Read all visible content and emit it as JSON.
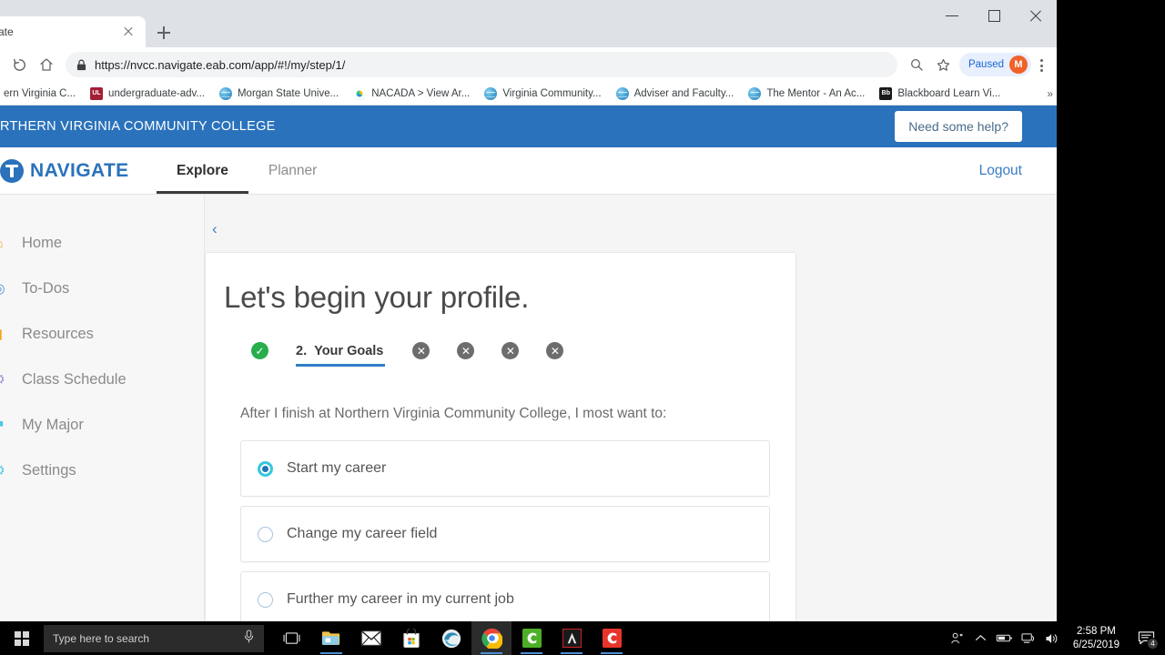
{
  "browser": {
    "tab": {
      "title": "ate",
      "close_icon": "close-icon"
    },
    "new_tab_icon": "plus-icon",
    "window_controls": {
      "minimize": "minimize-icon",
      "maximize": "maximize-icon",
      "close": "close-icon"
    },
    "toolbar": {
      "reload_icon": "reload-icon",
      "home_icon": "home-icon",
      "lock_icon": "lock-icon",
      "url_secure": "https://",
      "url_host": "nvcc.navigate.eab.com",
      "url_path": "/app/#!/my/step/1/",
      "url_full": "https://nvcc.navigate.eab.com/app/#!/my/step/1/",
      "zoom_icon": "zoom-search-icon",
      "bookmark_icon": "star-icon",
      "paused_label": "Paused",
      "avatar_initial": "M",
      "menu_icon": "kebab-menu-icon"
    },
    "bookmarks": [
      {
        "label": "ern Virginia C...",
        "icon": "globe-icon",
        "icon_kind": "globe"
      },
      {
        "label": "undergraduate-adv...",
        "icon": "ul-icon",
        "icon_kind": "ul",
        "icon_text": "UL",
        "icon_color": "#a31f34"
      },
      {
        "label": "Morgan State Unive...",
        "icon": "globe-icon",
        "icon_kind": "globe"
      },
      {
        "label": "NACADA > View Ar...",
        "icon": "nacada-icon",
        "icon_kind": "ring"
      },
      {
        "label": "Virginia Community...",
        "icon": "globe-icon",
        "icon_kind": "globe"
      },
      {
        "label": "Adviser and Faculty...",
        "icon": "globe-icon",
        "icon_kind": "globe"
      },
      {
        "label": "The Mentor - An Ac...",
        "icon": "globe-icon",
        "icon_kind": "globe"
      },
      {
        "label": "Blackboard Learn Vi...",
        "icon": "blackboard-icon",
        "icon_kind": "bb",
        "icon_text": "Bb",
        "icon_color": "#1a1a1a"
      }
    ],
    "bookmarks_overflow": "»"
  },
  "app": {
    "college_name": "RTHERN VIRGINIA COMMUNITY COLLEGE",
    "help_button": "Need some help?",
    "brand": "NAVIGATE",
    "brand_icon": "navigate-compass-icon",
    "nav_tabs": [
      {
        "label": "Explore",
        "active": true
      },
      {
        "label": "Planner",
        "active": false
      }
    ],
    "logout": "Logout",
    "sidebar": [
      {
        "label": "Home",
        "icon": "home-icon",
        "glyph": "⌂",
        "color": "#f0a030"
      },
      {
        "label": "To-Dos",
        "icon": "todos-icon",
        "glyph": "◎",
        "color": "#4a90d9"
      },
      {
        "label": "Resources",
        "icon": "resources-icon",
        "glyph": "▮",
        "color": "#f5a623"
      },
      {
        "label": "Class Schedule",
        "icon": "class-schedule-icon",
        "glyph": "⚙",
        "color": "#9b8fd4"
      },
      {
        "label": "My Major",
        "icon": "my-major-icon",
        "glyph": "⚑",
        "color": "#4bc8e8"
      },
      {
        "label": "Settings",
        "icon": "settings-icon",
        "glyph": "⚙",
        "color": "#4bc8e8"
      }
    ],
    "go_back": "Go back",
    "go_back_icon": "chevron-left-icon",
    "card": {
      "title": "Let's begin your profile.",
      "steps": [
        {
          "kind": "done",
          "glyph": "✓",
          "label": "",
          "number": ""
        },
        {
          "kind": "active",
          "number": "2.",
          "label": "Your Goals"
        },
        {
          "kind": "x",
          "glyph": "✕",
          "label": "",
          "number": ""
        },
        {
          "kind": "x",
          "glyph": "✕",
          "label": "",
          "number": ""
        },
        {
          "kind": "x",
          "glyph": "✕",
          "label": "",
          "number": ""
        },
        {
          "kind": "x",
          "glyph": "✕",
          "label": "",
          "number": ""
        }
      ],
      "question": "After I finish at Northern Virginia Community College, I most want to:",
      "options": [
        {
          "label": "Start my career",
          "selected": true
        },
        {
          "label": "Change my career field",
          "selected": false
        },
        {
          "label": "Further my career in my current job",
          "selected": false
        }
      ]
    }
  },
  "taskbar": {
    "start_icon": "windows-start-icon",
    "search_placeholder": "Type here to search",
    "mic_icon": "microphone-icon",
    "taskview_icon": "task-view-icon",
    "apps": [
      {
        "name": "file-explorer-icon",
        "running": true
      },
      {
        "name": "mail-icon",
        "running": false
      },
      {
        "name": "microsoft-store-icon",
        "running": false
      },
      {
        "name": "edge-icon",
        "running": false
      },
      {
        "name": "chrome-icon",
        "running": true,
        "active": true
      },
      {
        "name": "green-c-app-icon",
        "running": true
      },
      {
        "name": "adobe-acrobat-icon",
        "running": true
      },
      {
        "name": "red-c-app-icon",
        "running": true
      }
    ],
    "tray": [
      {
        "name": "people-icon",
        "glyph": "ʘ"
      },
      {
        "name": "show-hidden-icons-icon",
        "glyph": "⌃"
      },
      {
        "name": "battery-icon",
        "glyph": "▭"
      },
      {
        "name": "network-icon",
        "glyph": "⎕"
      },
      {
        "name": "volume-icon",
        "glyph": "ᴶ"
      }
    ],
    "time": "2:58 PM",
    "date": "6/25/2019",
    "notifications_icon": "action-center-icon",
    "notifications_count": "4"
  },
  "colors": {
    "brand_blue": "#2a72bb",
    "accent_link": "#3b7cc4",
    "step_done_green": "#27ae4b",
    "step_pending_gray": "#6d6d6d",
    "radio_selected_ring": "#35c8e0",
    "radio_selected_fill": "#1f74b8"
  }
}
